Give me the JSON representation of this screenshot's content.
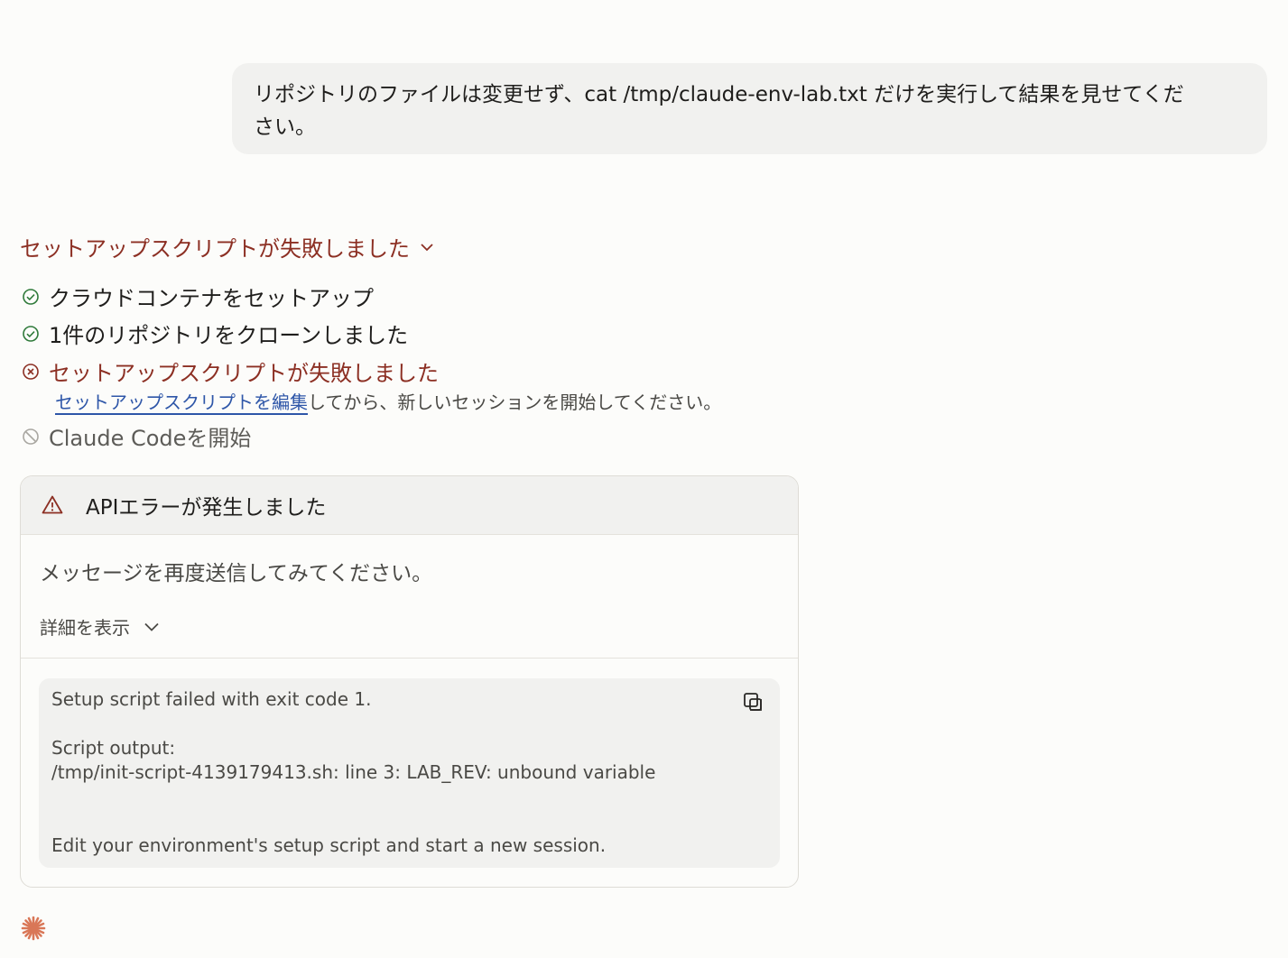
{
  "user_message": {
    "line1": "リポジトリのファイルは変更せず、cat /tmp/claude-env-lab.txt だけを実行して結果を見せてくだ",
    "line2": "さい。"
  },
  "setup": {
    "header": "セットアップスクリプトが失敗しました",
    "steps": [
      {
        "label": "クラウドコンテナをセットアップ",
        "status": "success"
      },
      {
        "label": "1件のリポジトリをクローンしました",
        "status": "success"
      },
      {
        "label": "セットアップスクリプトが失敗しました",
        "status": "failed"
      },
      {
        "label": "Claude Codeを開始",
        "status": "skipped"
      }
    ],
    "note_link": "セットアップスクリプトを編集",
    "note_rest": "してから、新しいセッションを開始してください。"
  },
  "error": {
    "title": "APIエラーが発生しました",
    "message": "メッセージを再度送信してみてください。",
    "details_label": "詳細を表示",
    "code_lines": [
      "Setup script failed with exit code 1.",
      "",
      "Script output:",
      "/tmp/init-script-4139179413.sh: line 3: LAB_REV: unbound variable",
      "",
      "",
      "Edit your environment's setup script and start a new session."
    ]
  },
  "colors": {
    "error": "#8c2f23",
    "success": "#2f7a3a",
    "link": "#2e56a8",
    "accent": "#d97757"
  }
}
